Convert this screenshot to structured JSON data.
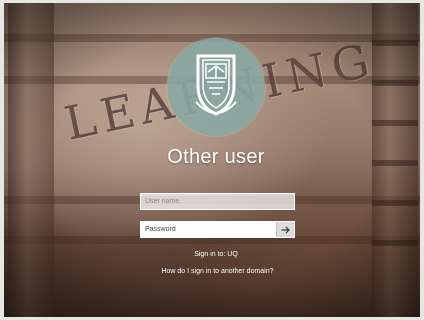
{
  "login": {
    "username_label": "Other user",
    "username_placeholder": "User name",
    "password_placeholder": "Password",
    "signin_target": "Sign in to: UQ",
    "other_domain_link": "How do I sign in to another domain?"
  },
  "background": {
    "carved_word": "LEARNING"
  },
  "colors": {
    "avatar_bg": "#8aa8a4",
    "text": "#ffffff",
    "field_border": "#ffffff"
  },
  "icons": {
    "submit": "arrow-right-icon",
    "avatar": "university-crest-icon"
  }
}
